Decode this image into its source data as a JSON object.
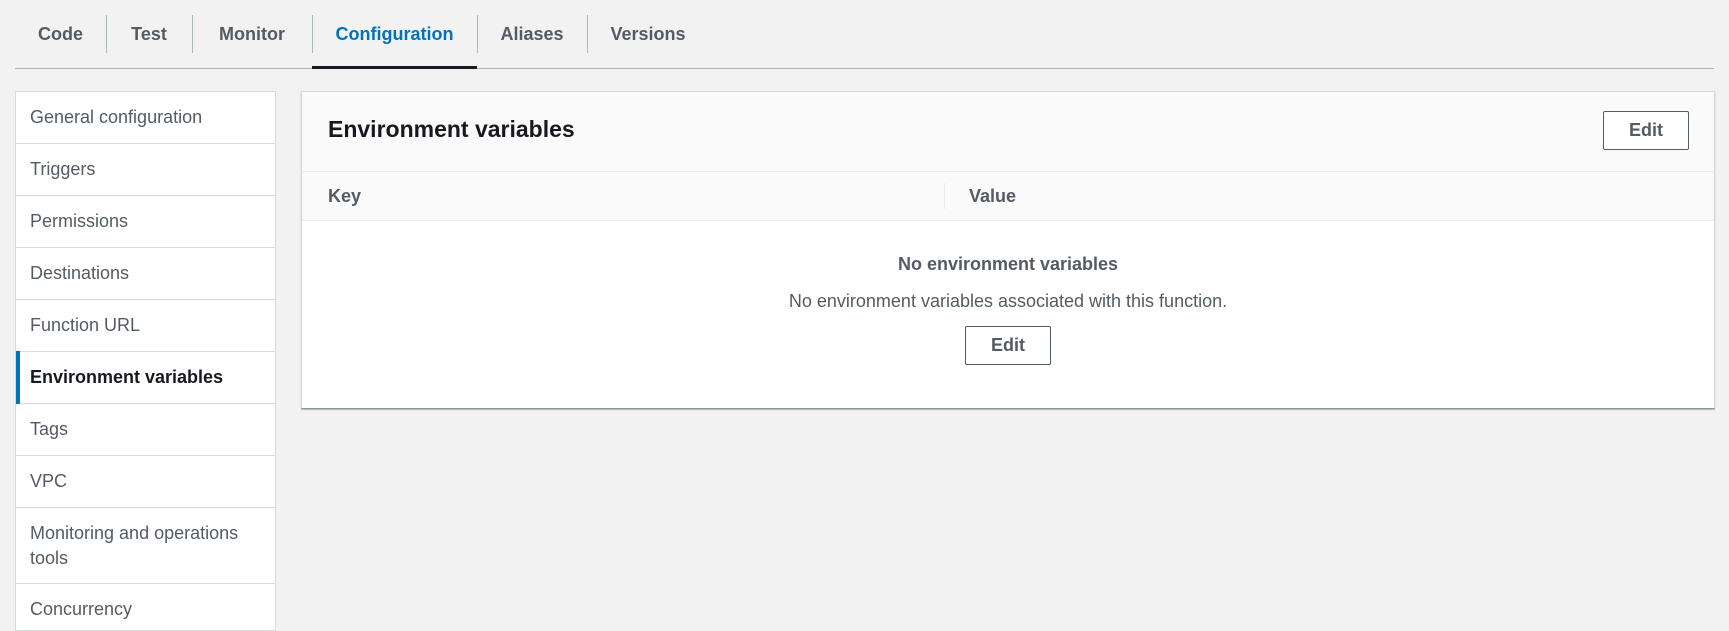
{
  "tabs": [
    {
      "label": "Code"
    },
    {
      "label": "Test"
    },
    {
      "label": "Monitor"
    },
    {
      "label": "Configuration"
    },
    {
      "label": "Aliases"
    },
    {
      "label": "Versions"
    }
  ],
  "sidenav": {
    "items": [
      {
        "label": "General configuration"
      },
      {
        "label": "Triggers"
      },
      {
        "label": "Permissions"
      },
      {
        "label": "Destinations"
      },
      {
        "label": "Function URL"
      },
      {
        "label": "Environment variables"
      },
      {
        "label": "Tags"
      },
      {
        "label": "VPC"
      },
      {
        "label": "Monitoring and operations tools"
      },
      {
        "label": "Concurrency"
      }
    ]
  },
  "panel": {
    "title": "Environment variables",
    "edit_label": "Edit",
    "columns": {
      "key": "Key",
      "value": "Value"
    },
    "empty": {
      "title": "No environment variables",
      "description": "No environment variables associated with this function.",
      "edit_label": "Edit"
    }
  },
  "colors": {
    "accent": "#0073bb",
    "text": "#16191f",
    "muted": "#545b64",
    "background": "#f2f2f2"
  }
}
